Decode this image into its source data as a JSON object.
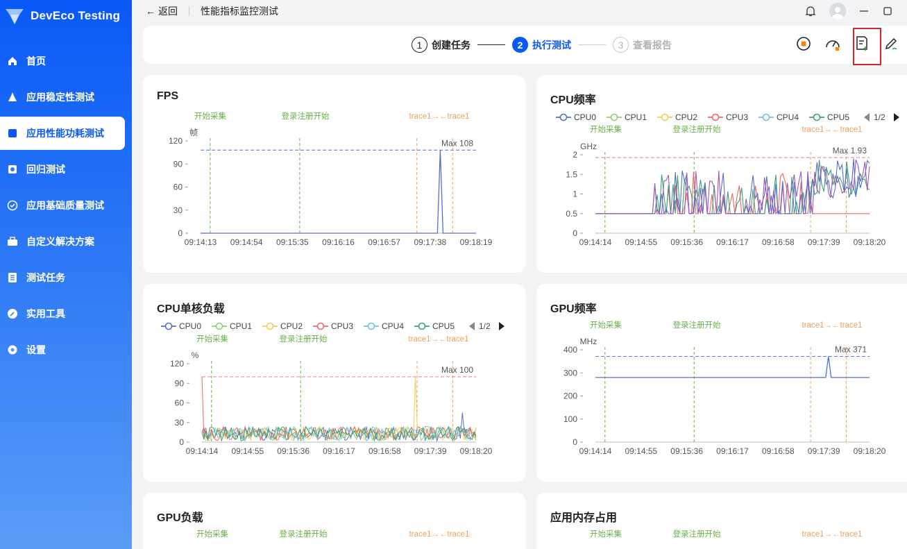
{
  "app": {
    "name": "DevEco Testing"
  },
  "sidebar": {
    "items": [
      {
        "label": "首页",
        "icon": "home-icon"
      },
      {
        "label": "应用稳定性测试",
        "icon": "stability-icon"
      },
      {
        "label": "应用性能功耗测试",
        "icon": "performance-icon",
        "active": true
      },
      {
        "label": "回归测试",
        "icon": "regression-icon"
      },
      {
        "label": "应用基础质量测试",
        "icon": "quality-icon"
      },
      {
        "label": "自定义解决方案",
        "icon": "toolbox-icon"
      },
      {
        "label": "测试任务",
        "icon": "task-list-icon"
      },
      {
        "label": "实用工具",
        "icon": "tool-icon"
      },
      {
        "label": "设置",
        "icon": "gear-icon"
      }
    ]
  },
  "topbar": {
    "back_label": "返回",
    "page_title": "性能指标监控测试"
  },
  "steps": [
    {
      "num": "1",
      "label": "创建任务",
      "state": "done"
    },
    {
      "num": "2",
      "label": "执行测试",
      "state": "active"
    },
    {
      "num": "3",
      "label": "查看报告",
      "state": "todo"
    }
  ],
  "markers": {
    "start": "开始采集",
    "login": "登录注册开始",
    "trace": "trace1→←trace1"
  },
  "colors": {
    "accent": "#0a59f7",
    "cpu0": "#5470c6",
    "cpu1": "#91cc75",
    "cpu2": "#fac858",
    "cpu3": "#ee6666",
    "cpu4": "#73c0de",
    "cpu5": "#3ba272",
    "max_line": "#e6799b"
  },
  "legend": {
    "cpus": [
      "CPU0",
      "CPU1",
      "CPU2",
      "CPU3",
      "CPU4",
      "CPU5"
    ],
    "page": "1/2"
  },
  "cards": {
    "fps": {
      "title": "FPS",
      "unit": "帧",
      "max_label": "Max 108"
    },
    "cpu_freq": {
      "title": "CPU频率",
      "unit": "GHz",
      "max_label": "Max 1.93"
    },
    "cpu_load": {
      "title": "CPU单核负载",
      "unit": "%",
      "max_label": "Max 100"
    },
    "gpu_freq": {
      "title": "GPU频率",
      "unit": "MHz",
      "max_label": "Max 371"
    },
    "gpu_load": {
      "title": "GPU负载"
    },
    "mem": {
      "title": "应用内存占用"
    }
  },
  "chart_data": [
    {
      "type": "line",
      "title": "FPS",
      "ylabel": "帧",
      "ylim": [
        0,
        120
      ],
      "yticks": [
        "0",
        "30",
        "60",
        "90",
        "120"
      ],
      "xticks": [
        "09:14:13",
        "09:14:54",
        "09:15:35",
        "09:16:16",
        "09:16:57",
        "09:17:38",
        "09:18:19"
      ],
      "max": 108,
      "series": [
        {
          "values": [
            0,
            0,
            0,
            0,
            0,
            0,
            0,
            0,
            0,
            0,
            0,
            108,
            0,
            0
          ]
        }
      ]
    },
    {
      "type": "line",
      "title": "CPU频率",
      "ylabel": "GHz",
      "ylim": [
        0,
        2
      ],
      "yticks": [
        "0",
        "0.5",
        "1",
        "1.5",
        "2"
      ],
      "xticks": [
        "09:14:14",
        "09:14:55",
        "09:15:36",
        "09:16:17",
        "09:16:58",
        "09:17:39",
        "09:18:20"
      ],
      "max": 1.93
    },
    {
      "type": "line",
      "title": "CPU单核负载",
      "ylabel": "%",
      "ylim": [
        0,
        120
      ],
      "yticks": [
        "0",
        "30",
        "60",
        "90",
        "120"
      ],
      "xticks": [
        "09:14:14",
        "09:14:55",
        "09:15:36",
        "09:16:17",
        "09:16:58",
        "09:17:39",
        "09:18:20"
      ],
      "max": 100
    },
    {
      "type": "line",
      "title": "GPU频率",
      "ylabel": "MHz",
      "ylim": [
        0,
        400
      ],
      "yticks": [
        "0",
        "100",
        "200",
        "300",
        "400"
      ],
      "xticks": [
        "09:14:14",
        "09:14:55",
        "09:15:36",
        "09:16:17",
        "09:16:58",
        "09:17:39",
        "09:18:20"
      ],
      "max": 371,
      "baseline": 280
    }
  ]
}
